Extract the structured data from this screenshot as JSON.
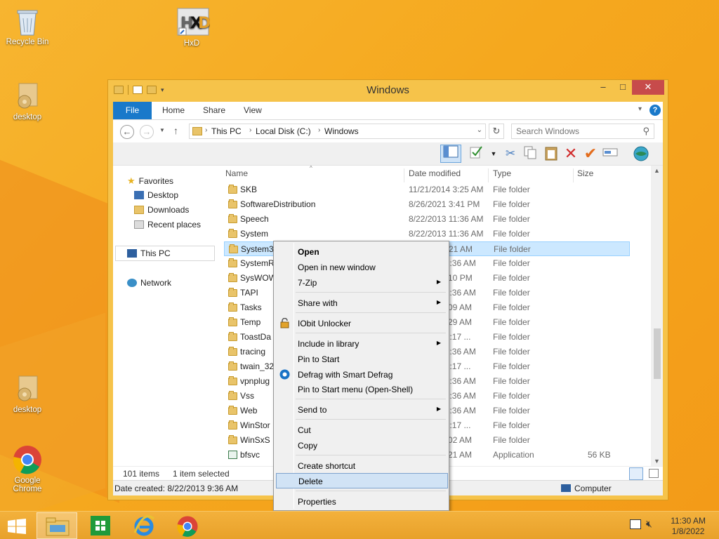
{
  "desktop": {
    "icons": [
      {
        "label": "Recycle Bin",
        "icon": "recycle-bin-icon"
      },
      {
        "label": "HxD",
        "icon": "hxd-icon"
      },
      {
        "label": "desktop",
        "icon": "settings-folder-icon"
      },
      {
        "label": "desktop",
        "icon": "settings-folder-icon"
      },
      {
        "label": "Google Chrome",
        "icon": "chrome-icon"
      }
    ]
  },
  "window": {
    "title": "Windows",
    "controls": {
      "minimize": "–",
      "maximize": "□",
      "close": "✕"
    },
    "ribbon": {
      "tabs": [
        "File",
        "Home",
        "Share",
        "View"
      ]
    },
    "address": {
      "crumbs": [
        "This PC",
        "Local Disk (C:)",
        "Windows"
      ],
      "search_placeholder": "Search Windows"
    },
    "nav": {
      "favorites": "Favorites",
      "items": [
        "Desktop",
        "Downloads",
        "Recent places"
      ],
      "this_pc": "This PC",
      "network": "Network"
    },
    "columns": {
      "name": "Name",
      "date": "Date modified",
      "type": "Type",
      "size": "Size"
    },
    "files": [
      {
        "name": "SKB",
        "date": "11/21/2014 3:25 AM",
        "type": "File folder",
        "size": ""
      },
      {
        "name": "SoftwareDistribution",
        "date": "8/26/2021 3:41 PM",
        "type": "File folder",
        "size": ""
      },
      {
        "name": "Speech",
        "date": "8/22/2013 11:36 AM",
        "type": "File folder",
        "size": ""
      },
      {
        "name": "System",
        "date": "8/22/2013 11:36 AM",
        "type": "File folder",
        "size": ""
      },
      {
        "name": "System3",
        "date": "1:21 AM",
        "type": "File folder",
        "size": ""
      },
      {
        "name": "SystemR",
        "date": "11:36 AM",
        "type": "File folder",
        "size": ""
      },
      {
        "name": "SysWOW",
        "date": "2:10 PM",
        "type": "File folder",
        "size": ""
      },
      {
        "name": "TAPI",
        "date": "11:36 AM",
        "type": "File folder",
        "size": ""
      },
      {
        "name": "Tasks",
        "date": "0:09 AM",
        "type": "File folder",
        "size": ""
      },
      {
        "name": "Temp",
        "date": "1:29 AM",
        "type": "File folder",
        "size": ""
      },
      {
        "name": "ToastDa",
        "date": "11:17 ...",
        "type": "File folder",
        "size": ""
      },
      {
        "name": "tracing",
        "date": "11:36 AM",
        "type": "File folder",
        "size": ""
      },
      {
        "name": "twain_32",
        "date": "11:17 ...",
        "type": "File folder",
        "size": ""
      },
      {
        "name": "vpnplug",
        "date": "11:36 AM",
        "type": "File folder",
        "size": ""
      },
      {
        "name": "Vss",
        "date": "11:36 AM",
        "type": "File folder",
        "size": ""
      },
      {
        "name": "Web",
        "date": "11:36 AM",
        "type": "File folder",
        "size": ""
      },
      {
        "name": "WinStor",
        "date": "11:17 ...",
        "type": "File folder",
        "size": ""
      },
      {
        "name": "WinSxS",
        "date": "9:02 AM",
        "type": "File folder",
        "size": ""
      },
      {
        "name": "bfsvc",
        "date": "7:21 AM",
        "type": "Application",
        "size": "56 KB"
      }
    ],
    "status": {
      "count": "101 items",
      "selected": "1 item selected"
    },
    "details": {
      "created": "Date created: 8/22/2013 9:36 AM",
      "location": "Computer"
    }
  },
  "context_menu": {
    "items": [
      {
        "label": "Open",
        "bold": true,
        "submenu": false
      },
      {
        "label": "Open in new window",
        "submenu": false
      },
      {
        "label": "7-Zip",
        "submenu": true
      },
      {
        "label": "Share with",
        "submenu": true
      },
      {
        "label": "IObit Unlocker",
        "submenu": false,
        "icon": "lock-icon"
      },
      {
        "label": "Include in library",
        "submenu": true
      },
      {
        "label": "Pin to Start",
        "submenu": false
      },
      {
        "label": "Defrag with Smart Defrag",
        "submenu": false,
        "icon": "smart-defrag-icon"
      },
      {
        "label": "Pin to Start menu (Open-Shell)",
        "submenu": false
      },
      {
        "label": "Send to",
        "submenu": true
      },
      {
        "label": "Cut",
        "submenu": false
      },
      {
        "label": "Copy",
        "submenu": false
      },
      {
        "label": "Create shortcut",
        "submenu": false
      },
      {
        "label": "Delete",
        "submenu": false,
        "highlighted": true
      },
      {
        "label": "Properties",
        "submenu": false
      }
    ]
  },
  "taskbar": {
    "apps": [
      "start",
      "file-explorer",
      "store",
      "internet-explorer",
      "chrome"
    ],
    "time": "11:30 AM",
    "date": "1/8/2022"
  },
  "colors": {
    "accent": "#1979ca",
    "desktop": "#f5a81e",
    "selection": "#cce8ff",
    "close": "#c74b4b"
  }
}
